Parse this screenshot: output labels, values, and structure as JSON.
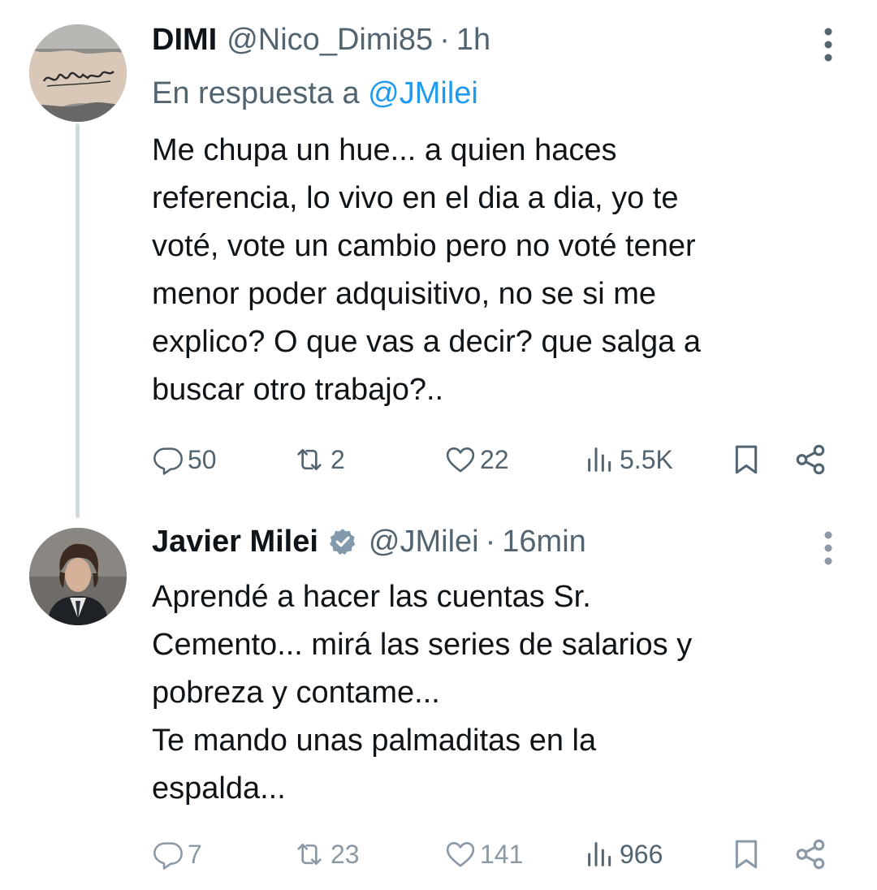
{
  "tweets": [
    {
      "display_name": "DIMI",
      "handle": "@Nico_Dimi85",
      "separator": "·",
      "time": "1h",
      "reply_prefix": "En respuesta a ",
      "reply_handle": "@JMilei",
      "text": "Me chupa un hue... a quien haces\nreferencia, lo vivo en el dia a dia, yo te\nvoté, vote un cambio pero no voté tener\nmenor poder adquisitivo, no se si me\nexplico? O que vas a decir? que salga a\nbuscar otro trabajo?..",
      "replies": "50",
      "retweets": "2",
      "likes": "22",
      "views": "5.5K"
    },
    {
      "display_name": "Javier Milei",
      "verified": true,
      "handle": "@JMilei",
      "separator": "·",
      "time": "16min",
      "text": "Aprendé a hacer las cuentas Sr.\nCemento... mirá las series de salarios y\npobreza y contame...\nTe mando unas palmaditas en la\nespalda...",
      "replies": "7",
      "retweets": "23",
      "likes": "141",
      "views": "966"
    }
  ],
  "icons": {
    "reply": "reply-icon",
    "retweet": "retweet-icon",
    "like": "heart-icon",
    "views": "views-icon",
    "bookmark": "bookmark-icon",
    "share": "share-icon",
    "more": "more-vertical-icon",
    "verified": "verified-badge-icon"
  },
  "colors": {
    "text": "#0f1419",
    "secondary": "#536471",
    "link": "#1d9bf0",
    "thread_line": "#cfd9de",
    "verified_badge": "#829aab"
  }
}
